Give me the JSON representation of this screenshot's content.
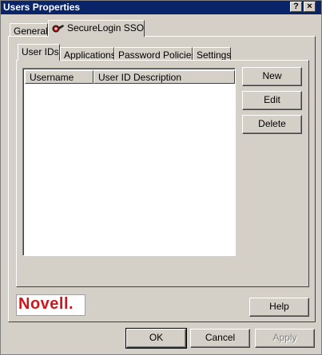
{
  "window": {
    "title": "Users Properties"
  },
  "titlebar_buttons": {
    "help": "?",
    "close": "×"
  },
  "outer_tabs": {
    "general": "General",
    "securelogin": "SecureLogin SSO"
  },
  "inner_tabs": {
    "user_ids": "User IDs",
    "applications": "Applications",
    "password_policies": "Password Policies",
    "settings": "Settings"
  },
  "list": {
    "columns": [
      "Username",
      "User ID Description"
    ],
    "rows": []
  },
  "side_buttons": {
    "new": "New",
    "edit": "Edit",
    "delete": "Delete"
  },
  "logo": {
    "text": "Novell."
  },
  "help_button": "Help",
  "dialog_buttons": {
    "ok": "OK",
    "cancel": "Cancel",
    "apply": "Apply"
  },
  "colors": {
    "titlebar": "#0a246a",
    "face": "#d4d0c8",
    "logo_red": "#d3141b"
  },
  "icons": {
    "securelogin_tab": "securelogin-key-icon"
  }
}
